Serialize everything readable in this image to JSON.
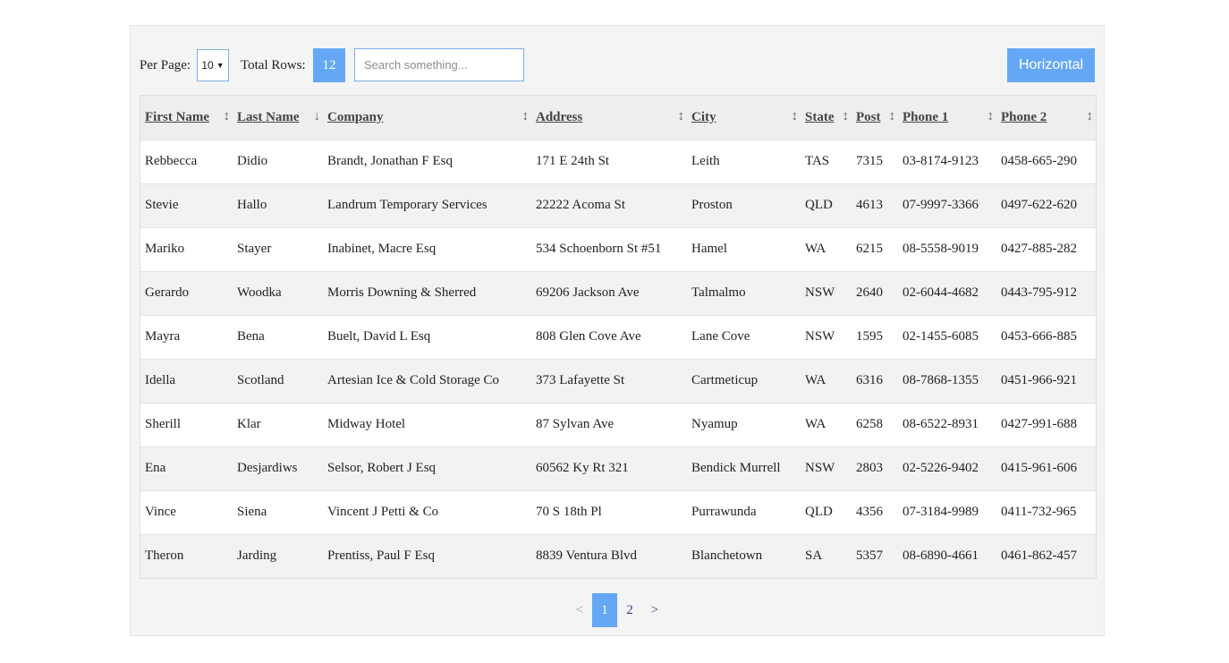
{
  "toolbar": {
    "per_page_label": "Per Page:",
    "per_page_value": "10",
    "total_rows_label": "Total Rows:",
    "total_rows_value": "12",
    "search_placeholder": "Search something...",
    "horizontal_label": "Horizontal"
  },
  "table": {
    "headers": [
      "First Name",
      "Last Name",
      "Company",
      "Address",
      "City",
      "State",
      "Post",
      "Phone 1",
      "Phone 2"
    ],
    "sort_icons": [
      "↕",
      "↓",
      "↕",
      "↕",
      "↕",
      "↕",
      "↕",
      "↕",
      "↕"
    ],
    "rows": [
      [
        "Rebbecca",
        "Didio",
        "Brandt, Jonathan F Esq",
        "171 E 24th St",
        "Leith",
        "TAS",
        "7315",
        "03-8174-9123",
        "0458-665-290"
      ],
      [
        "Stevie",
        "Hallo",
        "Landrum Temporary Services",
        "22222 Acoma St",
        "Proston",
        "QLD",
        "4613",
        "07-9997-3366",
        "0497-622-620"
      ],
      [
        "Mariko",
        "Stayer",
        "Inabinet, Macre Esq",
        "534 Schoenborn St #51",
        "Hamel",
        "WA",
        "6215",
        "08-5558-9019",
        "0427-885-282"
      ],
      [
        "Gerardo",
        "Woodka",
        "Morris Downing & Sherred",
        "69206 Jackson Ave",
        "Talmalmo",
        "NSW",
        "2640",
        "02-6044-4682",
        "0443-795-912"
      ],
      [
        "Mayra",
        "Bena",
        "Buelt, David L Esq",
        "808 Glen Cove Ave",
        "Lane Cove",
        "NSW",
        "1595",
        "02-1455-6085",
        "0453-666-885"
      ],
      [
        "Idella",
        "Scotland",
        "Artesian Ice & Cold Storage Co",
        "373 Lafayette St",
        "Cartmeticup",
        "WA",
        "6316",
        "08-7868-1355",
        "0451-966-921"
      ],
      [
        "Sherill",
        "Klar",
        "Midway Hotel",
        "87 Sylvan Ave",
        "Nyamup",
        "WA",
        "6258",
        "08-6522-8931",
        "0427-991-688"
      ],
      [
        "Ena",
        "Desjardiws",
        "Selsor, Robert J Esq",
        "60562 Ky Rt 321",
        "Bendick Murrell",
        "NSW",
        "2803",
        "02-5226-9402",
        "0415-961-606"
      ],
      [
        "Vince",
        "Siena",
        "Vincent J Petti & Co",
        "70 S 18th Pl",
        "Purrawunda",
        "QLD",
        "4356",
        "07-3184-9989",
        "0411-732-965"
      ],
      [
        "Theron",
        "Jarding",
        "Prentiss, Paul F Esq",
        "8839 Ventura Blvd",
        "Blanchetown",
        "SA",
        "5357",
        "08-6890-4661",
        "0461-862-457"
      ]
    ]
  },
  "pagination": {
    "prev_label": "<",
    "pages": [
      "1",
      "2"
    ],
    "current_page": "1",
    "next_label": ">"
  },
  "colors": {
    "accent": "#64a8f5",
    "panel_bg": "#f4f4f4",
    "header_bg": "#eeeeee",
    "row_alt_bg": "#f2f2f2"
  }
}
